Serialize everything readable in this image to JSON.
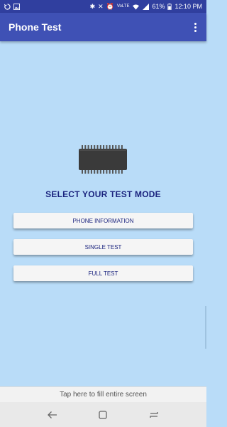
{
  "status_bar": {
    "battery": "61%",
    "time": "12:10 PM",
    "icons": [
      "sync-icon",
      "image-icon",
      "bluetooth-icon",
      "mute-icon",
      "alarm-icon",
      "volte-icon",
      "wifi-icon",
      "signal-icon",
      "battery-icon"
    ]
  },
  "app_bar": {
    "title": "Phone Test",
    "menu_icon": "overflow-menu-icon"
  },
  "main": {
    "icon": "chip-icon",
    "heading": "SELECT YOUR TEST MODE",
    "buttons": [
      {
        "label": "PHONE INFORMATION"
      },
      {
        "label": "SINGLE TEST"
      },
      {
        "label": "FULL TEST"
      }
    ]
  },
  "fill_screen_bar": {
    "label": "Tap here to fill entire screen"
  },
  "nav_bar": {
    "icons": [
      "back-icon",
      "home-icon",
      "recents-icon"
    ]
  },
  "colors": {
    "status_bar": "#303f9f",
    "app_bar": "#3f51b5",
    "background": "#b9dcf8",
    "text_accent": "#1a237e",
    "button_bg": "#f5f5f5"
  }
}
